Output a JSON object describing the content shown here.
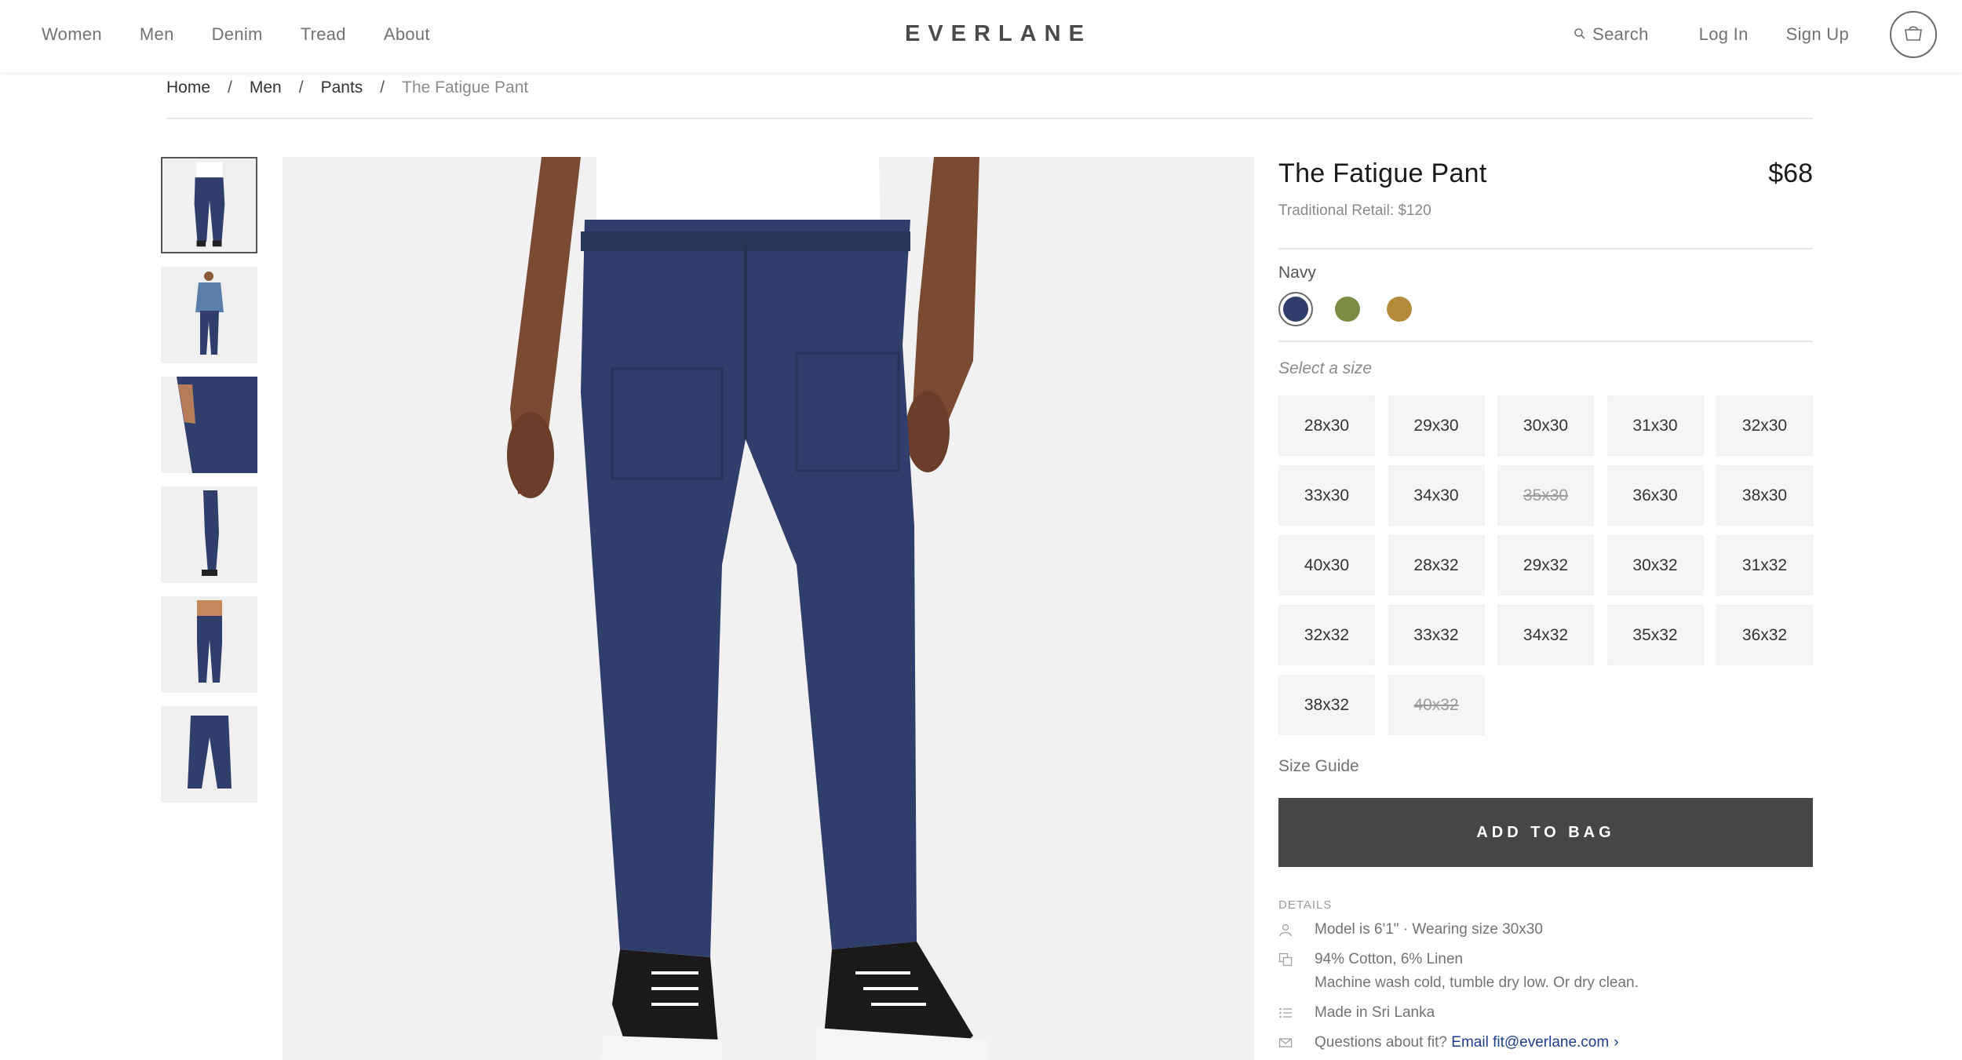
{
  "header": {
    "nav": [
      "Women",
      "Men",
      "Denim",
      "Tread",
      "About"
    ],
    "logo": "EVERLANE",
    "search_label": "Search",
    "login_label": "Log In",
    "signup_label": "Sign Up"
  },
  "breadcrumb": {
    "items": [
      "Home",
      "Men",
      "Pants"
    ],
    "separator": "/",
    "current": "The Fatigue Pant"
  },
  "product": {
    "title": "The Fatigue Pant",
    "price": "$68",
    "retail": "Traditional Retail: $120",
    "color_name": "Navy",
    "colors": [
      {
        "name": "Navy",
        "hex": "#2f3e6b",
        "selected": true
      },
      {
        "name": "Olive",
        "hex": "#7b8d45",
        "selected": false
      },
      {
        "name": "Khaki",
        "hex": "#b48b3a",
        "selected": false
      }
    ],
    "size_label": "Select a size",
    "sizes": [
      {
        "label": "28x30",
        "available": true
      },
      {
        "label": "29x30",
        "available": true
      },
      {
        "label": "30x30",
        "available": true
      },
      {
        "label": "31x30",
        "available": true
      },
      {
        "label": "32x30",
        "available": true
      },
      {
        "label": "33x30",
        "available": true
      },
      {
        "label": "34x30",
        "available": true
      },
      {
        "label": "35x30",
        "available": false
      },
      {
        "label": "36x30",
        "available": true
      },
      {
        "label": "38x30",
        "available": true
      },
      {
        "label": "40x30",
        "available": true
      },
      {
        "label": "28x32",
        "available": true
      },
      {
        "label": "29x32",
        "available": true
      },
      {
        "label": "30x32",
        "available": true
      },
      {
        "label": "31x32",
        "available": true
      },
      {
        "label": "32x32",
        "available": true
      },
      {
        "label": "33x32",
        "available": true
      },
      {
        "label": "34x32",
        "available": true
      },
      {
        "label": "35x32",
        "available": true
      },
      {
        "label": "36x32",
        "available": true
      },
      {
        "label": "38x32",
        "available": true
      },
      {
        "label": "40x32",
        "available": false
      }
    ],
    "size_guide": "Size Guide",
    "add_to_bag": "ADD TO BAG"
  },
  "details": {
    "heading": "DETAILS",
    "model": "Model is 6'1\"  ·  Wearing size 30x30",
    "fabric": "94% Cotton, 6% Linen",
    "care": "Machine wash cold, tumble dry low. Or dry clean.",
    "origin": "Made in Sri Lanka",
    "fit_question": "Questions about fit?",
    "fit_email": "Email fit@everlane.com"
  },
  "colors": {
    "add_button_bg": "#464646",
    "navy": "#2f3e6b",
    "link": "#1d3c8a"
  }
}
